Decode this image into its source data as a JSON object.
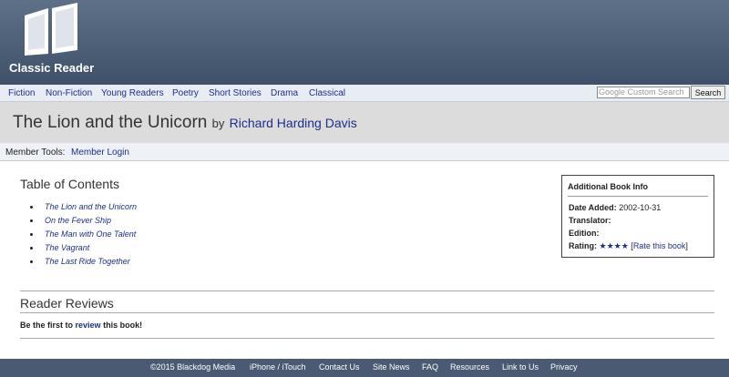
{
  "site": {
    "name": "Classic Reader"
  },
  "nav": {
    "items": [
      "Fiction",
      "Non-Fiction",
      "Young Readers",
      "Poetry",
      "Short Stories",
      "Drama",
      "Classical"
    ]
  },
  "search": {
    "placeholder": "Custom Search",
    "brand": "Google",
    "button_label": "Search"
  },
  "book": {
    "title": "The Lion and the Unicorn",
    "by": "by",
    "author": "Richard Harding Davis"
  },
  "member_tools": {
    "label": "Member Tools:",
    "login": "Member Login"
  },
  "toc": {
    "title": "Table of Contents",
    "chapters": [
      "The Lion and the Unicorn",
      "On the Fever Ship",
      "The Man with One Talent",
      "The Vagrant",
      "The Last Ride Together"
    ]
  },
  "info": {
    "title": "Additional Book Info",
    "date_added_label": "Date Added:",
    "date_added": "2002-10-31",
    "translator_label": "Translator:",
    "edition_label": "Edition:",
    "rating_label": "Rating:",
    "rating_stars": "★★★★",
    "rate_link": "Rate this book"
  },
  "reviews": {
    "title": "Reader Reviews",
    "prompt_prefix": "Be the first to",
    "prompt_link": "review",
    "prompt_suffix": "this book!"
  },
  "footer": {
    "items": [
      "©2015 Blackdog Media",
      "iPhone / iTouch",
      "Contact Us",
      "Site News",
      "FAQ",
      "Resources",
      "Link to Us",
      "Privacy"
    ]
  },
  "colors": {
    "header": "#4f6079",
    "link": "#1c2f8a",
    "footer": "#4a5a72"
  }
}
